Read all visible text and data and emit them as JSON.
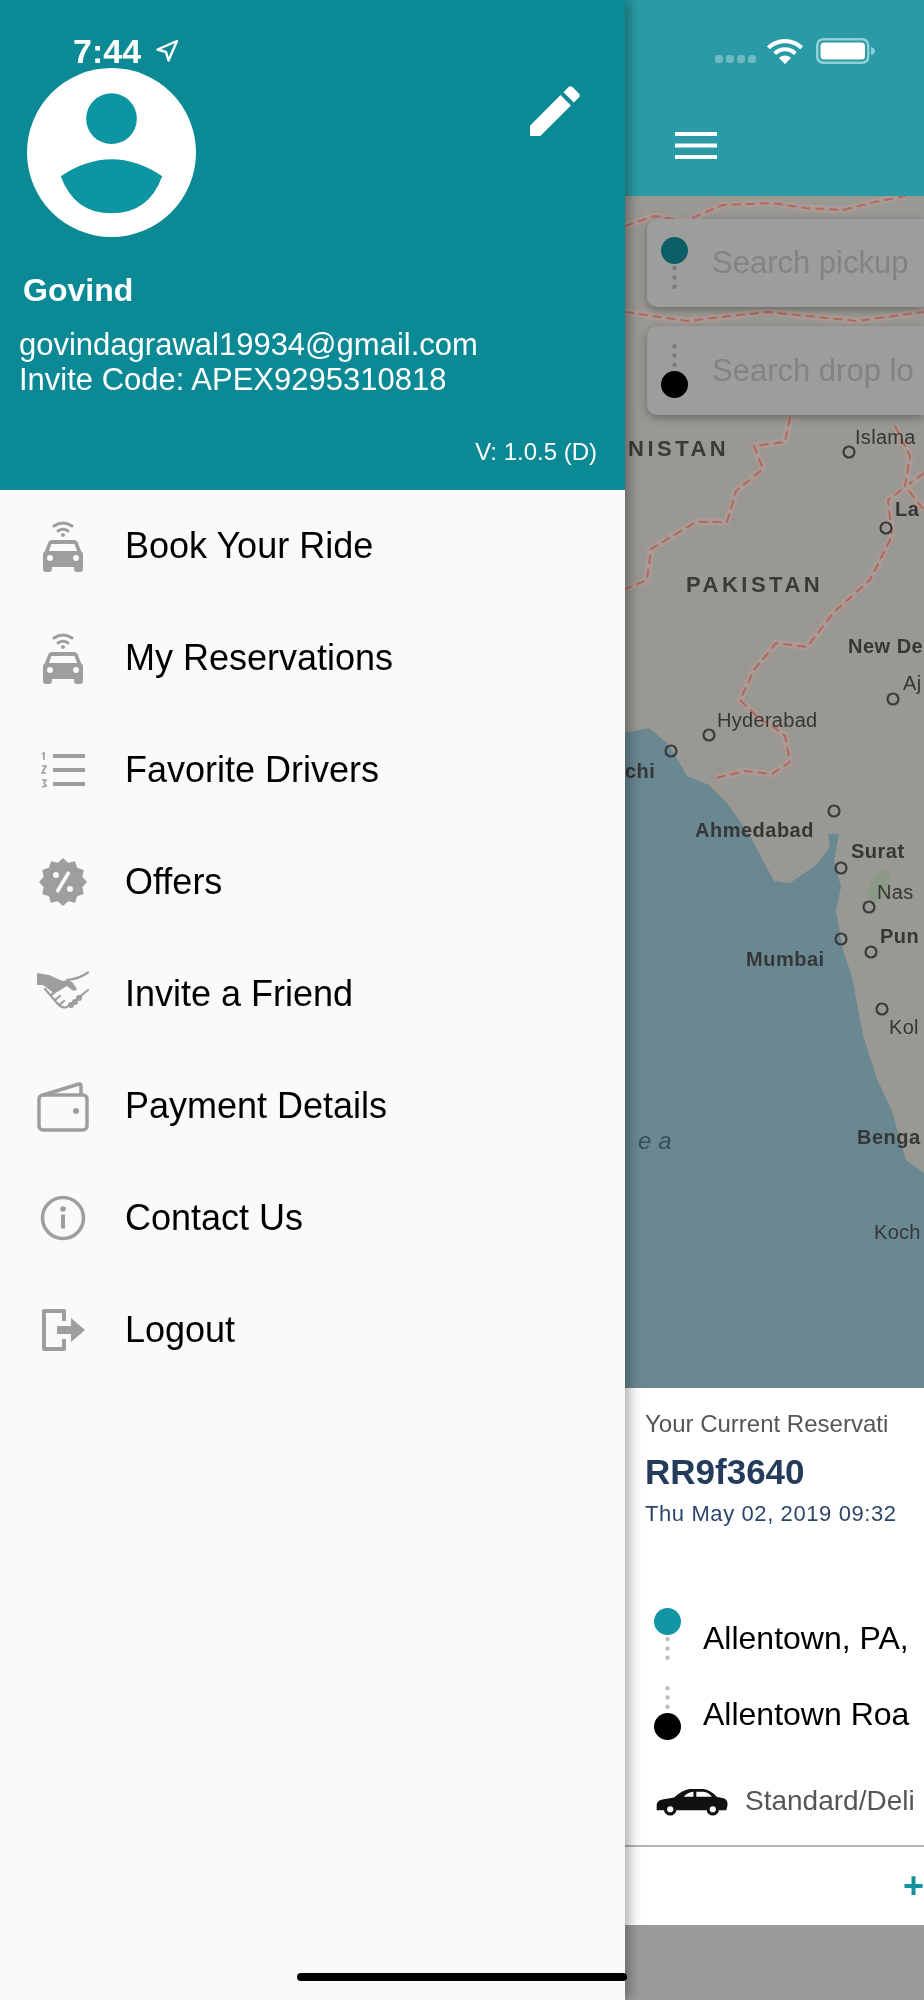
{
  "status_bar": {
    "time": "7:44"
  },
  "profile": {
    "name": "Govind",
    "email": "govindagrawal19934@gmail.com",
    "invite_code": "Invite Code: APEX9295310818",
    "version": "V: 1.0.5 (D)"
  },
  "menu": {
    "items": [
      {
        "label": "Book Your Ride",
        "kind": "ride"
      },
      {
        "label": "My Reservations",
        "kind": "reservations"
      },
      {
        "label": "Favorite Drivers",
        "kind": "favorites"
      },
      {
        "label": "Offers",
        "kind": "offers"
      },
      {
        "label": "Invite a Friend",
        "kind": "invite"
      },
      {
        "label": "Payment Details",
        "kind": "payment"
      },
      {
        "label": "Contact Us",
        "kind": "contact"
      },
      {
        "label": "Logout",
        "kind": "logout"
      }
    ]
  },
  "search_fields": [
    {
      "kind": "pickup",
      "placeholder": "Search pickup"
    },
    {
      "kind": "drop",
      "placeholder": "Search drop lo"
    }
  ],
  "map": {
    "labels": [
      {
        "text": "Islama",
        "kind": "town",
        "marker": true
      },
      {
        "text": "NISTAN",
        "kind": "country",
        "marker": false
      },
      {
        "text": "La",
        "kind": "city",
        "marker": true
      },
      {
        "text": "PAKISTAN",
        "kind": "country",
        "marker": false
      },
      {
        "text": "New De",
        "kind": "city",
        "marker": false
      },
      {
        "text": "Aj",
        "kind": "town",
        "marker": true
      },
      {
        "text": "Hyderabad",
        "kind": "town",
        "marker": true
      },
      {
        "text": "chi",
        "kind": "city",
        "marker": true
      },
      {
        "text": "Ahmedabad",
        "kind": "city",
        "marker": true
      },
      {
        "text": "Surat",
        "kind": "city",
        "marker": true
      },
      {
        "text": "Nas",
        "kind": "town",
        "marker": true
      },
      {
        "text": "Pun",
        "kind": "city",
        "marker": true
      },
      {
        "text": "Mumbai",
        "kind": "city",
        "marker": true
      },
      {
        "text": "Kol",
        "kind": "town",
        "marker": true
      },
      {
        "text": "Benga",
        "kind": "city",
        "marker": false
      },
      {
        "text": "ea",
        "kind": "sea",
        "marker": false
      },
      {
        "text": "Koch",
        "kind": "town",
        "marker": false
      }
    ]
  },
  "reservation": {
    "heading": "Your Current Reservati",
    "code": "RR9f3640",
    "datetime": "Thu May 02, 2019 09:32",
    "stops": [
      {
        "kind": "pickup",
        "address": "Allentown, PA,"
      },
      {
        "kind": "drop",
        "address": "Allentown Roa"
      }
    ],
    "vehicle": "Standard/Deli",
    "action": "+"
  }
}
